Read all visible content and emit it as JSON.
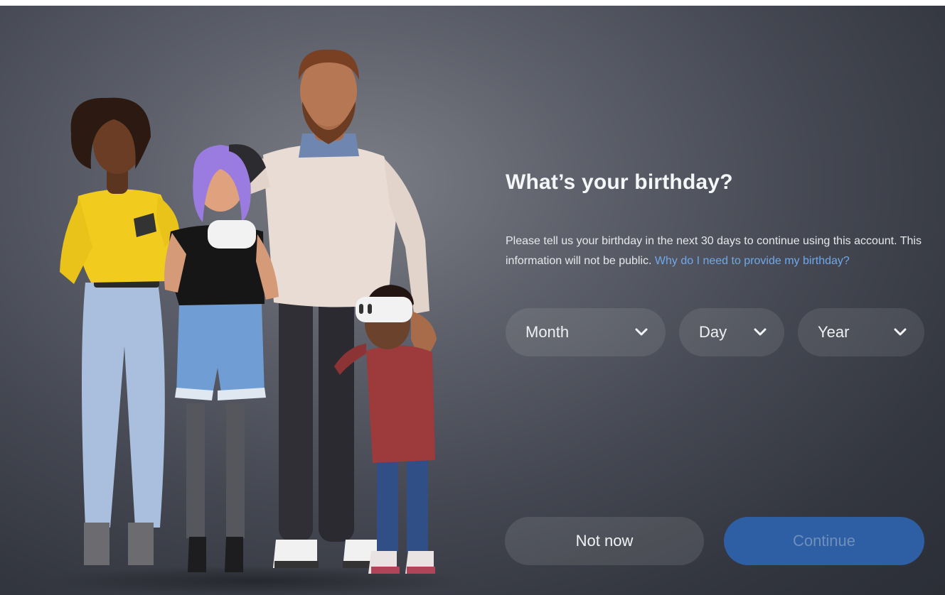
{
  "dialog": {
    "title": "What’s your birthday?",
    "description": "Please tell us your birthday in the next 30 days to continue using this account. This information will not be public. ",
    "help_link": "Why do I need to provide my birthday?"
  },
  "birthday_selects": {
    "month": {
      "selected": "Month",
      "icon": "chevron-down-icon"
    },
    "day": {
      "selected": "Day",
      "icon": "chevron-down-icon"
    },
    "year": {
      "selected": "Year",
      "icon": "chevron-down-icon"
    }
  },
  "actions": {
    "not_now_label": "Not now",
    "continue_label": "Continue",
    "continue_enabled": false
  },
  "colors": {
    "background": "#3e414a",
    "accent_link": "#6ea9ec",
    "continue_button": "#2e5ea3",
    "text": "#f5f6f8"
  }
}
